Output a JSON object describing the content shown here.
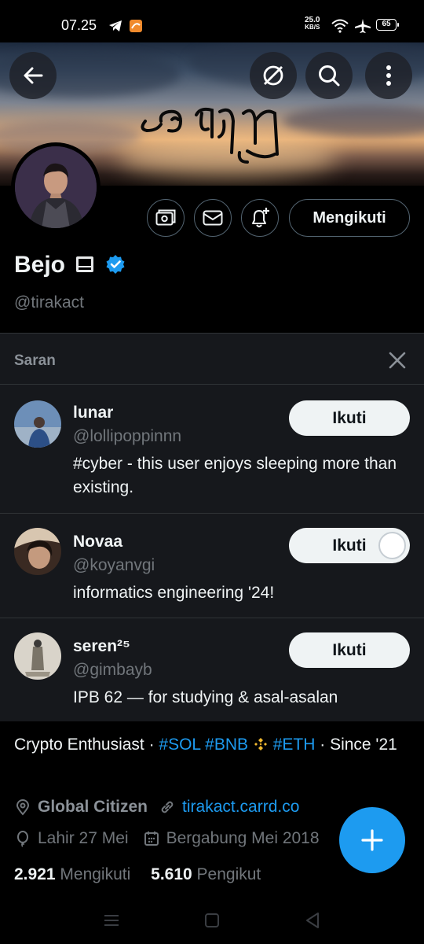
{
  "status_bar": {
    "time": "07.25",
    "net_speed_value": "25.0",
    "net_speed_unit": "KB/S",
    "battery_level": "65"
  },
  "profile": {
    "display_name": "Bejo",
    "handle": "@tirakact",
    "follow_state_label": "Mengikuti",
    "verified": true
  },
  "suggestions": {
    "title": "Saran",
    "items": [
      {
        "name": "lunar",
        "handle": "@lollipoppinnn",
        "bio": "#cyber - this user enjoys sleeping more than existing.",
        "button": "Ikuti"
      },
      {
        "name": "Novaa",
        "handle": "@koyanvgi",
        "bio": "informatics engineering '24!",
        "button": "Ikuti"
      },
      {
        "name": "seren²⁵",
        "handle": "@gimbayb",
        "bio": "IPB 62 — for studying & asal-asalan",
        "button": "Ikuti"
      }
    ]
  },
  "bio": {
    "text_start": "Crypto Enthusiast · ",
    "tag_sol": "#SOL",
    "tag_bnb": "#BNB",
    "tag_eth": "#ETH",
    "text_end": " · Since '21"
  },
  "meta": {
    "location": "Global Citizen",
    "link": "tirakact.carrd.co",
    "birthday": "Lahir 27 Mei",
    "joined": "Bergabung Mei 2018"
  },
  "stats": {
    "following_count": "2.921",
    "following_label": "Mengikuti",
    "followers_count": "5.610",
    "followers_label": "Pengikut"
  },
  "colors": {
    "accent": "#1d9bf0",
    "background": "#000000",
    "panel": "#16181c",
    "muted_text": "#71767b"
  }
}
